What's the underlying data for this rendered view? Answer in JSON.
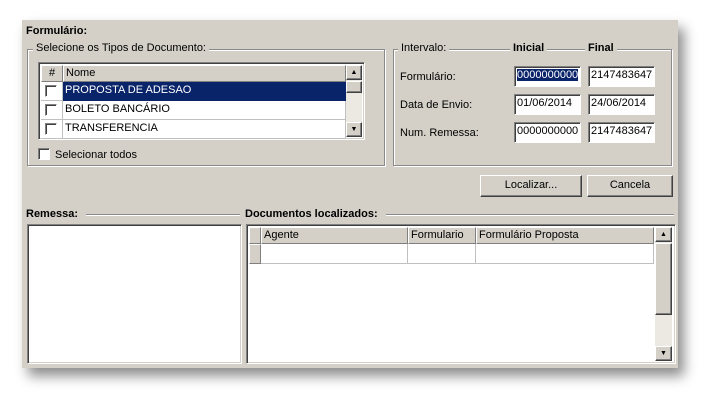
{
  "title": "Formulário:",
  "doc_types": {
    "legend": "Selecione os Tipos de Documento:",
    "columns": [
      "#",
      "Nome"
    ],
    "rows": [
      {
        "name": "PROPOSTA DE ADESAO",
        "selected": true
      },
      {
        "name": "BOLETO BANCÁRIO",
        "selected": false
      },
      {
        "name": "TRANSFERENCIA",
        "selected": false
      }
    ],
    "select_all": "Selecionar todos"
  },
  "interval": {
    "legend": "Intervalo:",
    "initial_label": "Inicial",
    "final_label": "Final",
    "rows": [
      {
        "label": "Formulário:",
        "initial": "0000000000",
        "final": "2147483647"
      },
      {
        "label": "Data de Envio:",
        "initial": "01/06/2014",
        "final": "24/06/2014"
      },
      {
        "label": "Num. Remessa:",
        "initial": "0000000000",
        "final": "2147483647"
      }
    ]
  },
  "buttons": {
    "search": "Localizar...",
    "cancel": "Cancela"
  },
  "remessa": {
    "label": "Remessa:"
  },
  "documents": {
    "label": "Documentos localizados:",
    "columns": [
      "Agente",
      "Formulario",
      "Formulário Proposta"
    ]
  },
  "icons": {
    "up": "▲",
    "down": "▼"
  }
}
